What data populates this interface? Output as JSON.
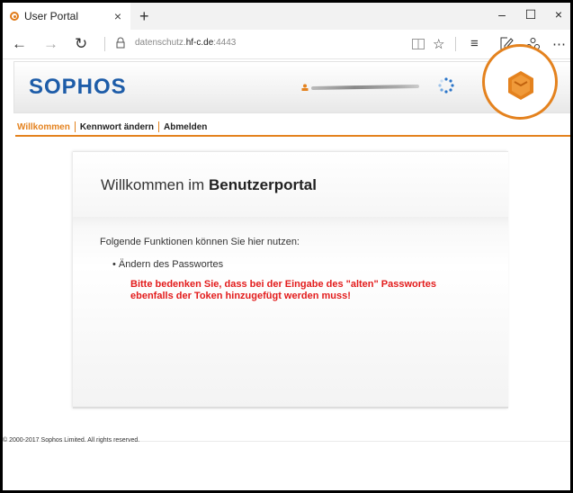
{
  "browser": {
    "tab_title": "User Portal",
    "tab_close": "×",
    "new_tab": "+",
    "window_minimize": "–",
    "window_maximize": "☐",
    "window_close": "×",
    "nav_back": "←",
    "nav_forward": "→",
    "nav_refresh": "↻",
    "url_prefix": "datenschutz.",
    "url_host": "hf-c.de",
    "url_suffix": ":4443",
    "icons": [
      "back-icon",
      "forward-icon",
      "refresh-icon",
      "lock-icon",
      "reading-view-icon",
      "favorite-star-icon",
      "hub-icon",
      "web-note-icon",
      "share-icon",
      "more-icon"
    ]
  },
  "header": {
    "logo": "SOPHOS",
    "colors": {
      "brand_blue": "#1d5ca8",
      "brand_orange": "#e4821e"
    }
  },
  "nav": {
    "items": [
      {
        "label": "Willkommen",
        "active": true
      },
      {
        "label": "Kennwort ändern",
        "active": false
      },
      {
        "label": "Abmelden",
        "active": false
      }
    ]
  },
  "content": {
    "title_prefix": "Willkommen im",
    "title_bold": "Benutzerportal",
    "intro": "Folgende Funktionen können Sie hier nutzen:",
    "bullet": "• Ändern des Passwortes",
    "warning_line1": "Bitte bedenken Sie, dass bei der Eingabe des \"alten\" Passwortes",
    "warning_line2": "ebenfalls der Token hinzugefügt werden muss!",
    "warning_color": "#e31b1b"
  },
  "footer": {
    "copyright": "© 2000-2017 Sophos Limited. All rights reserved."
  }
}
